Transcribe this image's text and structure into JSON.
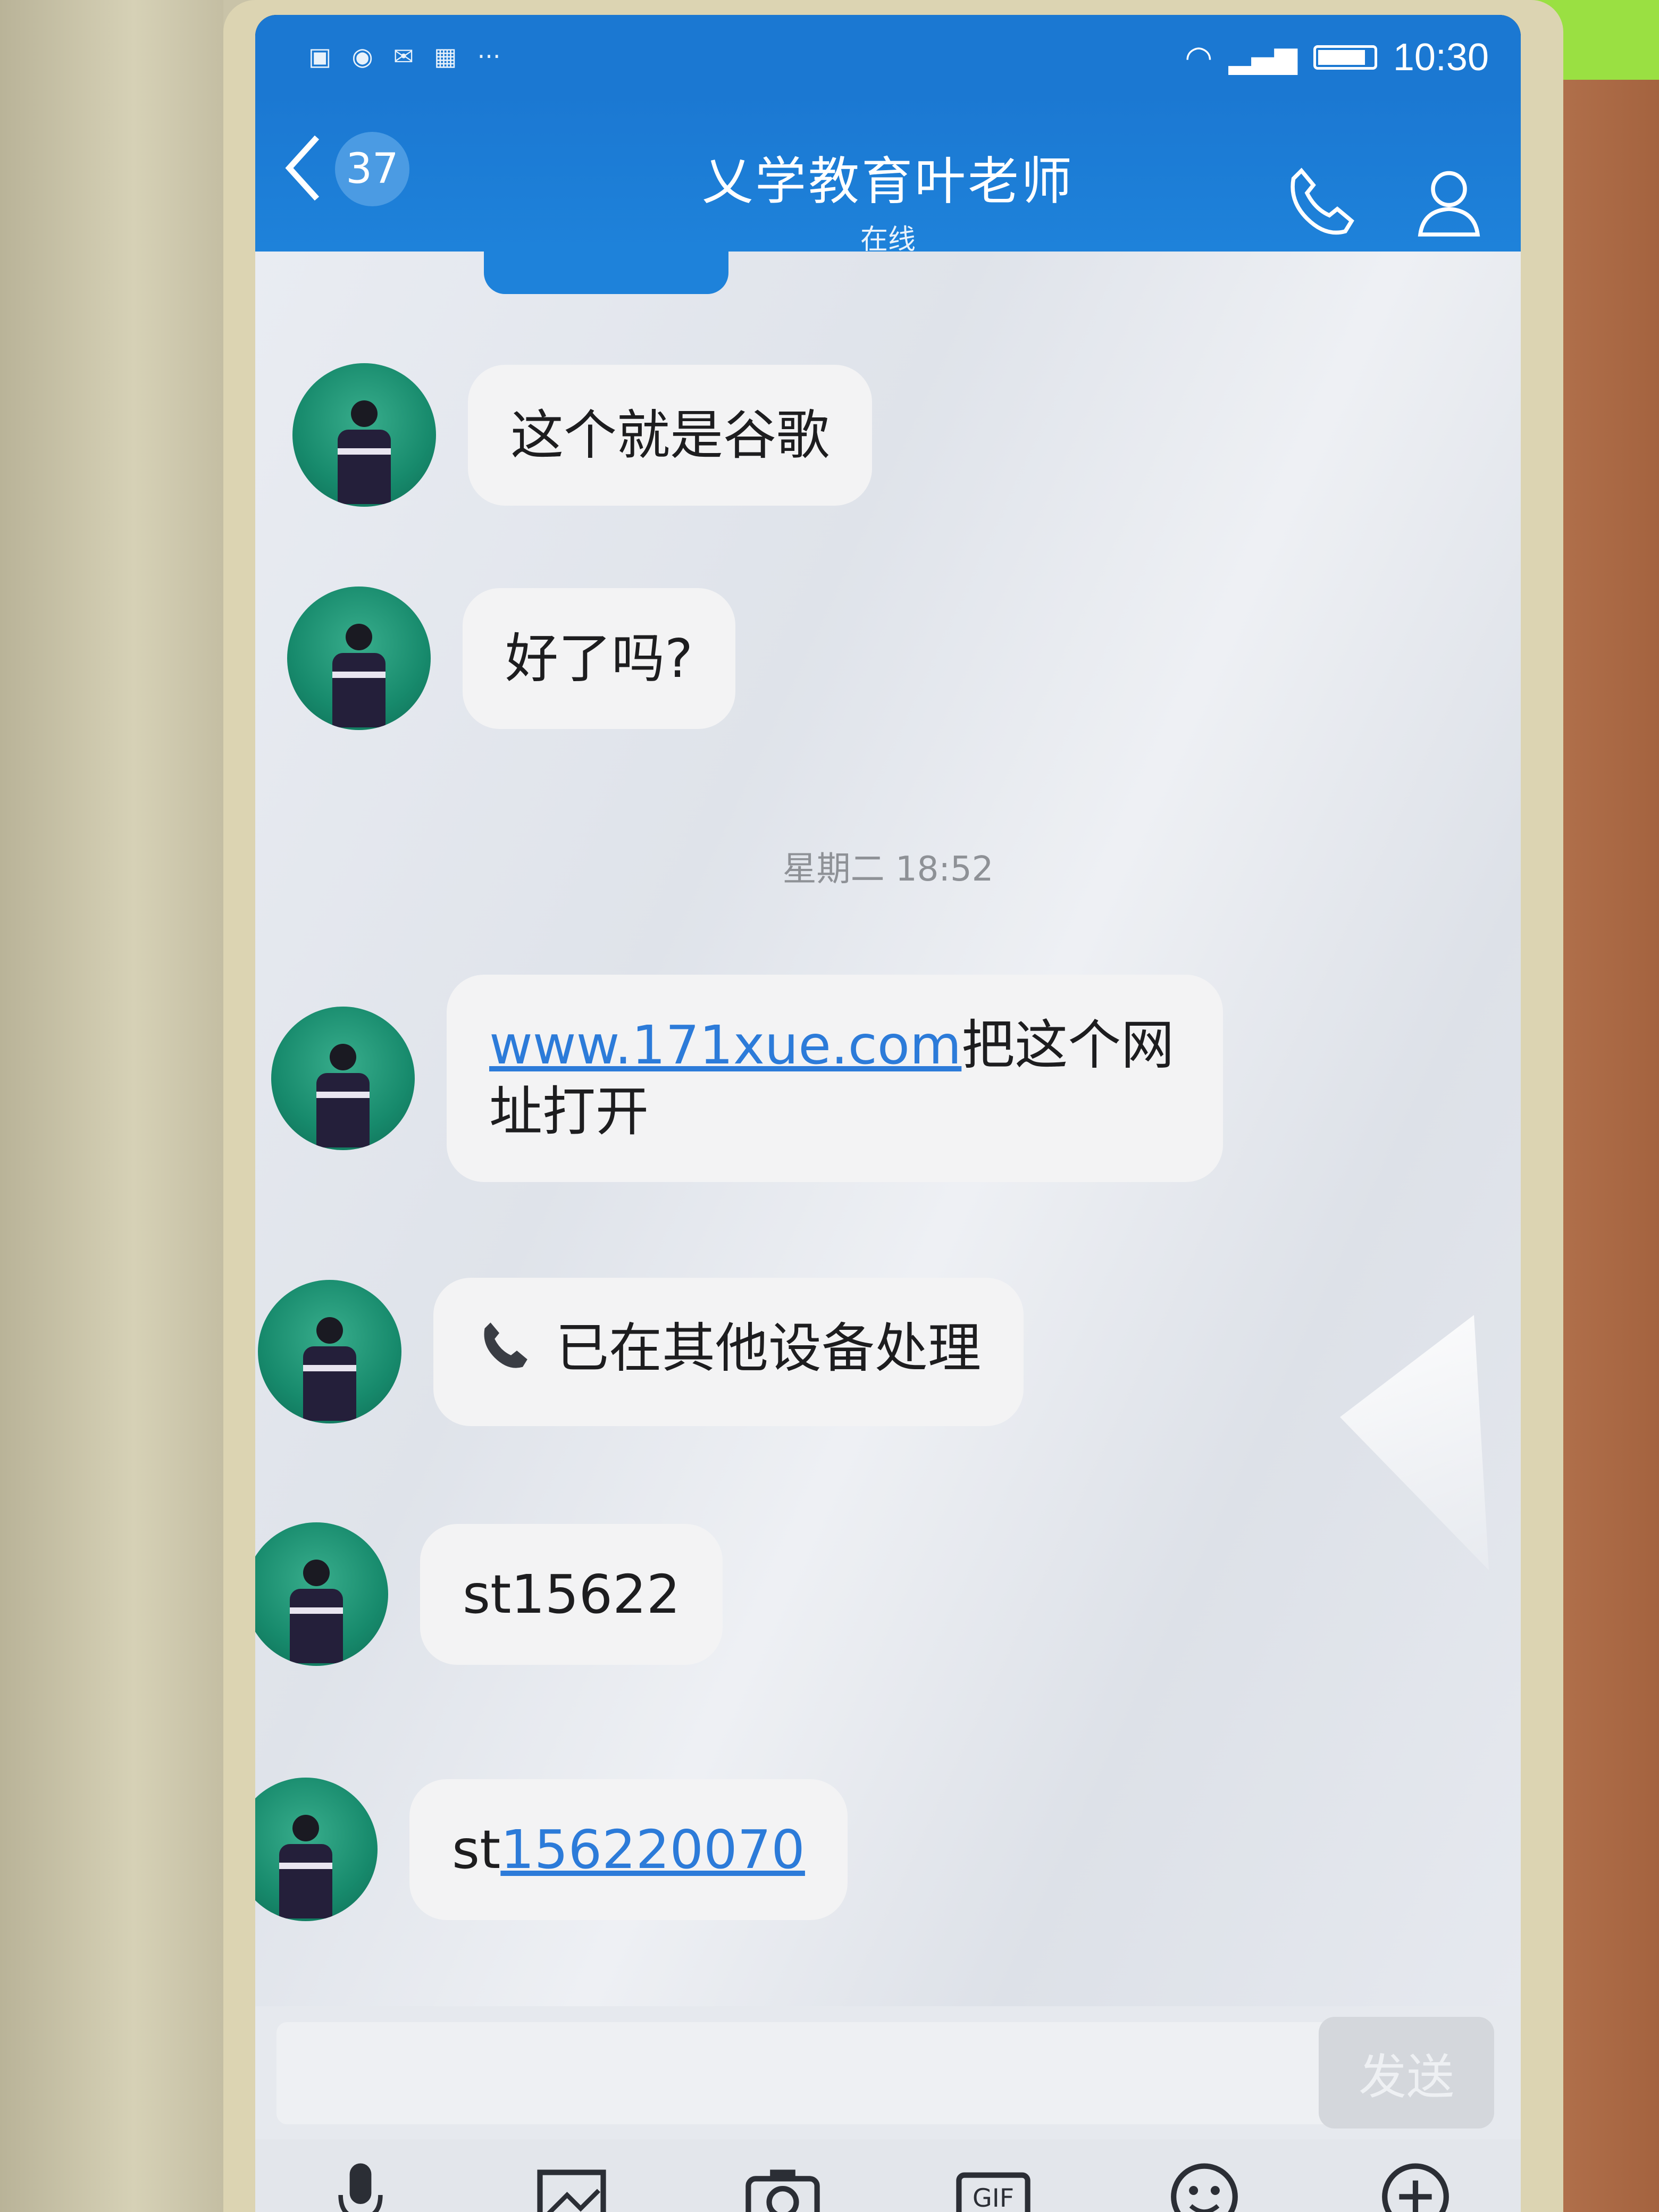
{
  "status_bar": {
    "time": "10:30",
    "notification_icons": [
      "image-icon",
      "wechat-icon",
      "mail-icon",
      "apps-icon",
      "more-icon"
    ],
    "signal_icons": [
      "wifi-icon",
      "signal-icon",
      "battery-icon"
    ]
  },
  "header": {
    "back_count": "37",
    "title": "乂学教育叶老师",
    "status": "在线",
    "actions": [
      "phone-icon",
      "profile-icon"
    ]
  },
  "messages": [
    {
      "type": "text",
      "text": "这个就是谷歌"
    },
    {
      "type": "text",
      "text": "好了吗?"
    },
    {
      "type": "divider",
      "text": "星期二 18:52"
    },
    {
      "type": "link",
      "link": "www.171xue.com",
      "text": "把这个网址打开"
    },
    {
      "type": "call",
      "text": "已在其他设备处理"
    },
    {
      "type": "text",
      "text": "st15622"
    },
    {
      "type": "link",
      "prefix": "st",
      "link": "156220070"
    }
  ],
  "input": {
    "placeholder": "",
    "send_label": "发送"
  },
  "toolbar": [
    "mic-icon",
    "image-icon",
    "camera-icon",
    "gif-icon",
    "emoji-icon",
    "plus-icon"
  ],
  "colors": {
    "header": "#1b78d2",
    "bubble": "#f3f3f4",
    "link": "#2c7bd9",
    "chat_bg": "#e6e9ef"
  }
}
